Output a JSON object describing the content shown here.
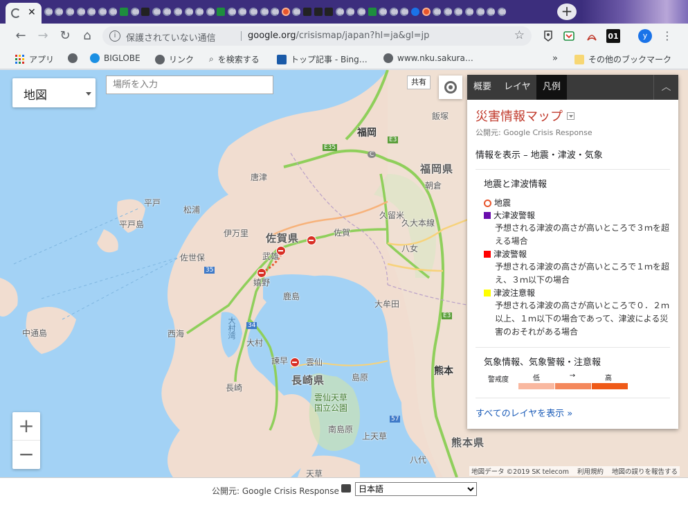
{
  "browser": {
    "active_tab_close": "✕",
    "new_tab": "+",
    "address": {
      "security_label": "保護されていない通信",
      "host": "google.org",
      "path": "/crisismap/japan?hl=ja&gl=jp"
    },
    "avatar_letter": "y",
    "ext_01": "01"
  },
  "bookmarks": {
    "items": [
      {
        "label": "アプリ",
        "icon": "apps-grid-icon"
      },
      {
        "label": "",
        "icon": "globe-icon"
      },
      {
        "label": "BIGLOBE",
        "icon": "biglobe-icon"
      },
      {
        "label": "リンク",
        "icon": "globe-icon"
      },
      {
        "label": "を検索する",
        "icon": "search-icon"
      },
      {
        "label": "トップ記事 - Bing…",
        "icon": "bing-icon"
      },
      {
        "label": "www.nku.sakura…",
        "icon": "globe-icon"
      }
    ],
    "overflow": "»",
    "other": "その他のブックマーク"
  },
  "map": {
    "map_type": "地図",
    "search_placeholder": "場所を入力",
    "share": "共有",
    "zoom_in": "+",
    "zoom_out": "−",
    "labels": {
      "fukuoka_city": "福岡",
      "fukuoka_pref": "福岡県",
      "saga_pref": "佐賀県",
      "nagasaki_pref": "長崎県",
      "kumamoto_city": "熊本",
      "kumamoto_pref": "熊本県",
      "iizuka": "飯塚",
      "asakura": "朝倉",
      "karatsu": "唐津",
      "hirado": "平戸",
      "hiradoshima": "平戸島",
      "matsuura": "松浦",
      "imari": "伊万里",
      "saga": "佐賀",
      "kurume": "久留米",
      "kurume_line": "久大本線",
      "yame": "八女",
      "sasebo": "佐世保",
      "takeo": "武雄",
      "ureshino": "嬉野",
      "kashima": "鹿島",
      "omuta": "大牟田",
      "nakadori": "中通島",
      "saikai": "西海",
      "omura_bay": "大村湾",
      "omura": "大村",
      "isahaya": "諫早",
      "unzen": "雲仙",
      "shimabara": "島原",
      "nagasaki": "長崎",
      "unzen_park": "雲仙天草\n国立公園",
      "minamishimabara": "南島原",
      "kamiamakusa": "上天草",
      "yatsushiro": "八代",
      "amakusa": "天草",
      "e35": "E35",
      "e3": "E3",
      "e3b": "E3",
      "r35": "35",
      "r34": "34",
      "r57": "57",
      "c": "C"
    },
    "attribution": [
      "地図データ ©2019 SK telecom",
      "利用規約",
      "地図の誤りを報告する"
    ]
  },
  "panel": {
    "tabs": [
      "概要",
      "レイヤ",
      "凡例"
    ],
    "active_tab": "凡例",
    "collapse": "︿",
    "title": "災害情報マップ",
    "publisher": "公開元: Google Crisis Response",
    "showing": "情報を表示 – 地震・津波・気象",
    "quake_section": {
      "heading": "地震と津波情報",
      "items": [
        {
          "label": "地震",
          "icon": "earthquake-icon",
          "color": "#e8552c",
          "desc": ""
        },
        {
          "label": "大津波警報",
          "color": "#6a0dad",
          "desc": "予想される津波の高さが高いところで３ｍを超える場合"
        },
        {
          "label": "津波警報",
          "color": "#ff0000",
          "desc": "予想される津波の高さが高いところで１ｍを超え、３ｍ以下の場合"
        },
        {
          "label": "津波注意報",
          "color": "#ffff00",
          "desc": "予想される津波の高さが高いところで０．２ｍ以上、１ｍ以下の場合であって、津波による災害のおそれがある場合"
        }
      ]
    },
    "weather_section": {
      "heading": "気象情報、気象警報・注意報",
      "scale_label": "警戒度",
      "low": "低",
      "arrow": "→",
      "high": "高",
      "colors": [
        "#f9b8a0",
        "#f4885c",
        "#ef5a18"
      ]
    },
    "all_layers": "すべてのレイヤを表示 »"
  },
  "footer": {
    "publisher": "公開元: Google Crisis Response ·",
    "language": "日本語"
  }
}
